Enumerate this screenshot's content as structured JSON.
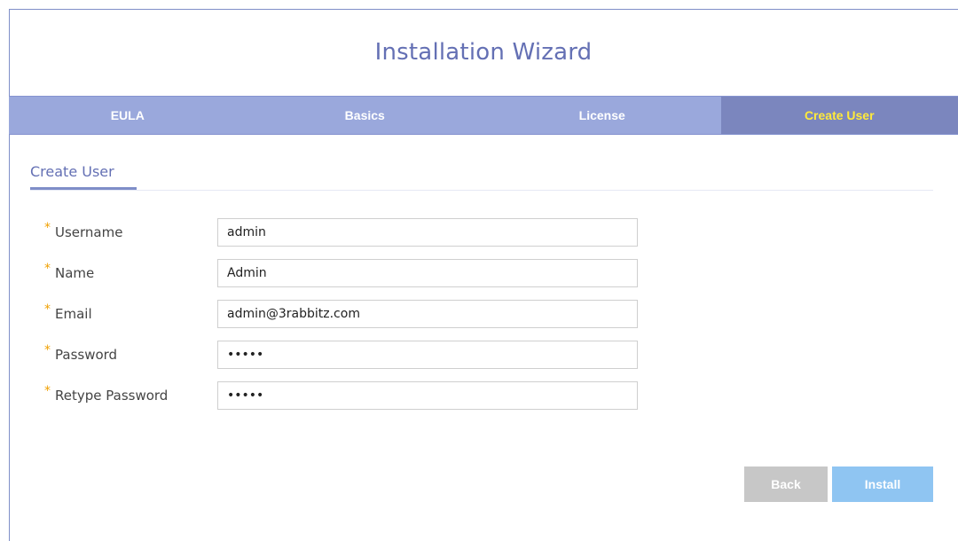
{
  "title": "Installation Wizard",
  "steps": [
    {
      "label": "EULA",
      "active": false
    },
    {
      "label": "Basics",
      "active": false
    },
    {
      "label": "License",
      "active": false
    },
    {
      "label": "Create User",
      "active": true
    }
  ],
  "section": {
    "tab_label": "Create User"
  },
  "form": {
    "required_marker": "*",
    "fields": [
      {
        "label": "Username",
        "value": "admin",
        "type": "text"
      },
      {
        "label": "Name",
        "value": "Admin",
        "type": "text"
      },
      {
        "label": "Email",
        "value": "admin@3rabbitz.com",
        "type": "text"
      },
      {
        "label": "Password",
        "value": "admin",
        "type": "password"
      },
      {
        "label": "Retype Password",
        "value": "admin",
        "type": "password"
      }
    ]
  },
  "buttons": {
    "back_label": "Back",
    "install_label": "Install"
  },
  "colors": {
    "title": "#6470b4",
    "step_bar": "#9aa8dc",
    "step_active": "#7b86be",
    "step_active_text": "#ffea3a",
    "required": "#f0a000",
    "back_button": "#c7c7c7",
    "install_button": "#8fc5f2"
  }
}
